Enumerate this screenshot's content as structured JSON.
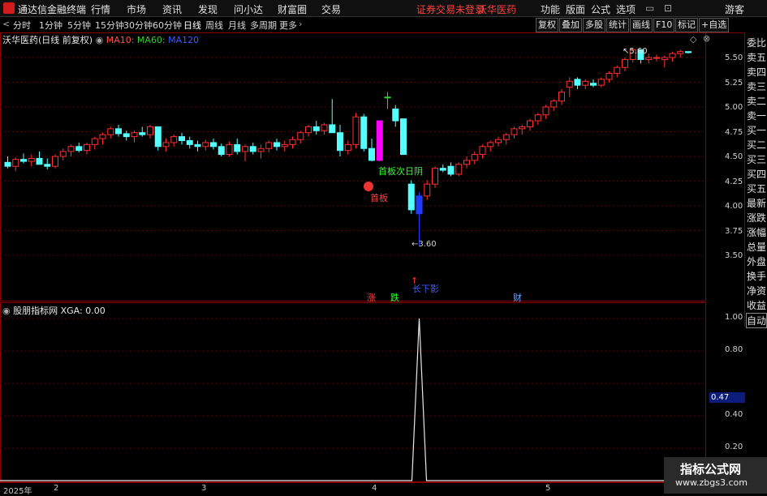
{
  "app": {
    "title": "通达信金融终端"
  },
  "menu": [
    "行情",
    "市场",
    "资讯",
    "发现",
    "问小达",
    "财富圈",
    "交易"
  ],
  "status": {
    "warning": "证券交易未登录",
    "stock": "沃华医药"
  },
  "menu_right": [
    "功能",
    "版面",
    "公式",
    "选项"
  ],
  "user": "游客",
  "periods": [
    "分时",
    "1分钟",
    "5分钟",
    "15分钟",
    "30分钟",
    "60分钟",
    "日线",
    "周线",
    "月线",
    "多周期",
    "更多"
  ],
  "active_period": "日线",
  "toolbar_right": [
    "复权",
    "叠加",
    "多股",
    "统计",
    "画线",
    "F10",
    "标记",
    "+自选"
  ],
  "chart_header": {
    "title": "沃华医药(日线 前复权)",
    "ma10": "MA10:",
    "ma60": "MA60:",
    "ma120": "MA120"
  },
  "annotations": {
    "first_board": "首板",
    "first_board_yin": "首板次日阴",
    "long_lower": "长下影",
    "low_price": "3.60",
    "high_price": "5.60",
    "zhang": "涨",
    "die": "跌",
    "cai": "财"
  },
  "indicator_header": {
    "name": "股朋指标网",
    "value": "XGA: 0.00"
  },
  "indicator_current": "0.47",
  "side_panel": [
    "委比",
    "卖五",
    "卖四",
    "卖三",
    "卖二",
    "卖一",
    "买一",
    "买二",
    "买三",
    "买四",
    "买五",
    "最新",
    "涨跌",
    "涨幅",
    "总量",
    "外盘",
    "换手",
    "净资",
    "收益",
    "自动"
  ],
  "dates": [
    "2025年",
    "2",
    "3",
    "4",
    "5"
  ],
  "watermark": {
    "line1": "指标公式网",
    "line2": "www.zbgs3.com"
  },
  "colors": {
    "up": "#ff3030",
    "down": "#54ffff",
    "ma10": "#ff4d4d",
    "ma60": "#33cc33",
    "ma120": "#3b5bff",
    "limit_up": "#ff00ff",
    "green_bar": "#22dd22",
    "blue_bar": "#1f3bff"
  },
  "chart_data": {
    "type": "candlestick",
    "y_ticks_main": [
      "5.50",
      "5.25",
      "5.00",
      "4.75",
      "4.50",
      "4.25",
      "4.00",
      "3.75",
      "3.50"
    ],
    "y_ticks_indicator": [
      "1.00",
      "0.80",
      "0.40",
      "0.20"
    ],
    "ylim_main": [
      3.3,
      5.75
    ],
    "ylim_indicator": [
      0,
      1.1
    ],
    "candles": [
      [
        4.44,
        4.5,
        4.38,
        4.4
      ],
      [
        4.4,
        4.49,
        4.35,
        4.47
      ],
      [
        4.47,
        4.53,
        4.43,
        4.45
      ],
      [
        4.45,
        4.52,
        4.4,
        4.48
      ],
      [
        4.48,
        4.55,
        4.42,
        4.42
      ],
      [
        4.42,
        4.48,
        4.37,
        4.4
      ],
      [
        4.4,
        4.52,
        4.38,
        4.5
      ],
      [
        4.5,
        4.58,
        4.46,
        4.55
      ],
      [
        4.55,
        4.62,
        4.5,
        4.6
      ],
      [
        4.6,
        4.64,
        4.54,
        4.56
      ],
      [
        4.56,
        4.64,
        4.52,
        4.62
      ],
      [
        4.62,
        4.7,
        4.57,
        4.68
      ],
      [
        4.68,
        4.74,
        4.62,
        4.72
      ],
      [
        4.72,
        4.8,
        4.68,
        4.78
      ],
      [
        4.78,
        4.82,
        4.7,
        4.73
      ],
      [
        4.73,
        4.76,
        4.66,
        4.7
      ],
      [
        4.7,
        4.76,
        4.64,
        4.74
      ],
      [
        4.74,
        4.8,
        4.7,
        4.72
      ],
      [
        4.72,
        4.82,
        4.68,
        4.8
      ],
      [
        4.8,
        4.78,
        4.56,
        4.6
      ],
      [
        4.6,
        4.68,
        4.55,
        4.64
      ],
      [
        4.64,
        4.72,
        4.6,
        4.7
      ],
      [
        4.7,
        4.74,
        4.62,
        4.66
      ],
      [
        4.66,
        4.7,
        4.58,
        4.62
      ],
      [
        4.62,
        4.66,
        4.55,
        4.6
      ],
      [
        4.6,
        4.67,
        4.56,
        4.64
      ],
      [
        4.64,
        4.68,
        4.57,
        4.6
      ],
      [
        4.6,
        4.63,
        4.5,
        4.52
      ],
      [
        4.52,
        4.65,
        4.5,
        4.62
      ],
      [
        4.62,
        4.68,
        4.52,
        4.55
      ],
      [
        4.55,
        4.62,
        4.45,
        4.6
      ],
      [
        4.6,
        4.64,
        4.52,
        4.55
      ],
      [
        4.55,
        4.62,
        4.48,
        4.58
      ],
      [
        4.58,
        4.66,
        4.54,
        4.64
      ],
      [
        4.64,
        4.68,
        4.56,
        4.6
      ],
      [
        4.6,
        4.66,
        4.55,
        4.62
      ],
      [
        4.62,
        4.7,
        4.58,
        4.67
      ],
      [
        4.67,
        4.76,
        4.63,
        4.74
      ],
      [
        4.74,
        4.82,
        4.7,
        4.8
      ],
      [
        4.8,
        4.86,
        4.72,
        4.76
      ],
      [
        4.76,
        4.84,
        4.72,
        4.82
      ],
      [
        4.82,
        5.08,
        4.8,
        4.74
      ],
      [
        4.74,
        4.82,
        4.5,
        4.56
      ],
      [
        4.56,
        4.66,
        4.52,
        4.62
      ],
      [
        4.62,
        4.94,
        4.58,
        4.9
      ],
      [
        4.9,
        4.93,
        4.55,
        4.58
      ],
      [
        4.58,
        4.68,
        4.45,
        4.46
      ],
      [
        4.46,
        4.86,
        4.45,
        4.86
      ],
      [
        5.1,
        5.15,
        4.98,
        5.1
      ],
      [
        4.98,
        5.02,
        4.8,
        4.86
      ],
      [
        4.88,
        4.88,
        4.52,
        4.52
      ],
      [
        4.22,
        4.26,
        3.92,
        3.96
      ],
      [
        3.92,
        4.14,
        3.6,
        4.1
      ],
      [
        4.1,
        4.26,
        4.06,
        4.22
      ],
      [
        4.22,
        4.4,
        4.18,
        4.38
      ],
      [
        4.38,
        4.42,
        4.34,
        4.36
      ],
      [
        4.4,
        4.44,
        4.3,
        4.32
      ],
      [
        4.32,
        4.44,
        4.3,
        4.42
      ],
      [
        4.42,
        4.5,
        4.38,
        4.46
      ],
      [
        4.46,
        4.55,
        4.42,
        4.52
      ],
      [
        4.52,
        4.62,
        4.48,
        4.6
      ],
      [
        4.6,
        4.66,
        4.55,
        4.64
      ],
      [
        4.64,
        4.7,
        4.6,
        4.67
      ],
      [
        4.67,
        4.74,
        4.62,
        4.72
      ],
      [
        4.72,
        4.8,
        4.68,
        4.78
      ],
      [
        4.78,
        4.82,
        4.72,
        4.8
      ],
      [
        4.8,
        4.88,
        4.76,
        4.86
      ],
      [
        4.86,
        4.94,
        4.82,
        4.92
      ],
      [
        4.92,
        5.02,
        4.88,
        5.0
      ],
      [
        5.0,
        5.08,
        4.96,
        5.06
      ],
      [
        5.06,
        5.18,
        5.02,
        5.15
      ],
      [
        5.2,
        5.3,
        5.1,
        5.26
      ],
      [
        5.28,
        5.3,
        5.18,
        5.22
      ],
      [
        5.22,
        5.28,
        5.18,
        5.26
      ],
      [
        5.24,
        5.28,
        5.2,
        5.22
      ],
      [
        5.22,
        5.3,
        5.2,
        5.28
      ],
      [
        5.28,
        5.36,
        5.25,
        5.34
      ],
      [
        5.34,
        5.42,
        5.3,
        5.4
      ],
      [
        5.4,
        5.5,
        5.36,
        5.48
      ],
      [
        5.48,
        5.6,
        5.45,
        5.58
      ],
      [
        5.58,
        5.56,
        5.44,
        5.48
      ],
      [
        5.48,
        5.54,
        5.44,
        5.5
      ],
      [
        5.5,
        5.53,
        5.46,
        5.5
      ],
      [
        5.48,
        5.52,
        5.4,
        5.5
      ],
      [
        5.5,
        5.56,
        5.46,
        5.54
      ],
      [
        5.54,
        5.58,
        5.5,
        5.56
      ],
      [
        5.56,
        5.56,
        5.54,
        5.55
      ]
    ],
    "special": {
      "limit_up_index": 47,
      "green_index": 48,
      "blue_index": 52
    },
    "indicator_spike_index": 52
  }
}
